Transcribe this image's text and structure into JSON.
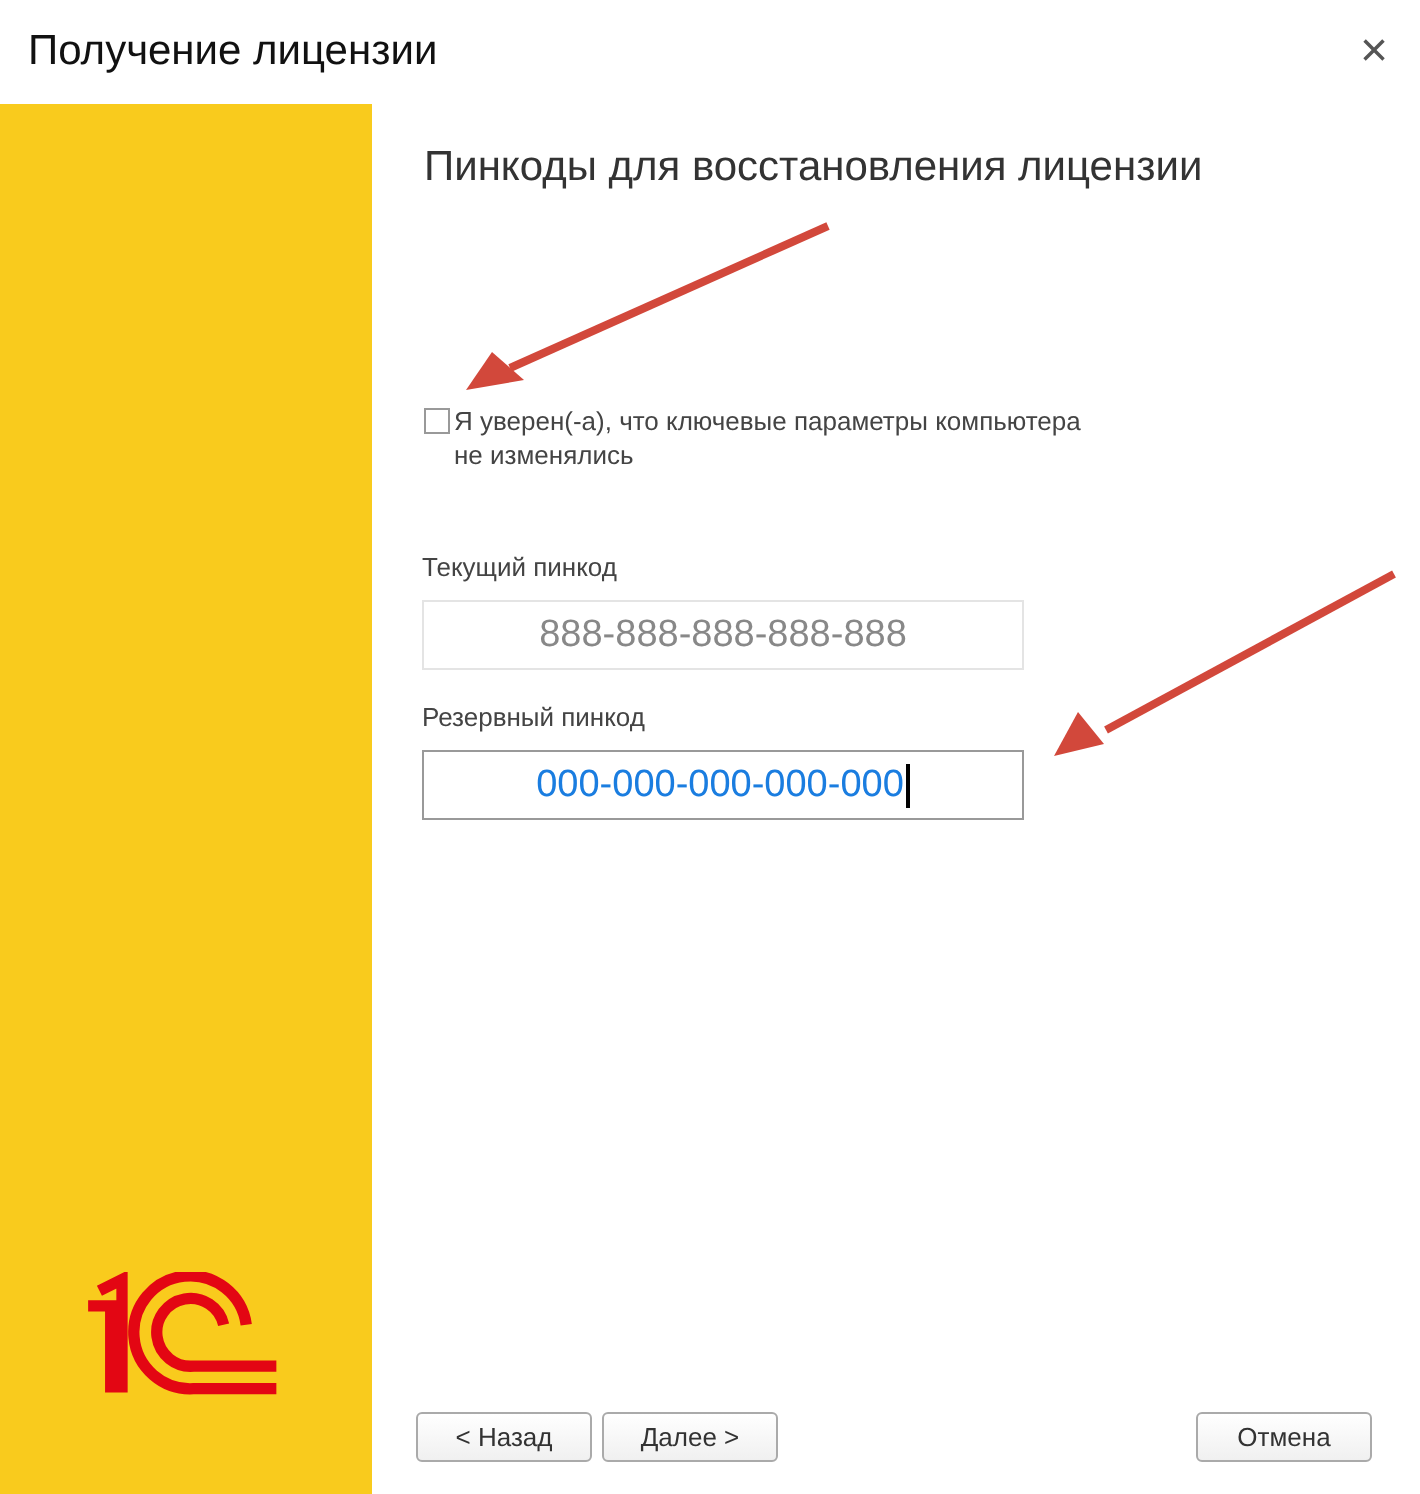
{
  "window": {
    "title": "Получение лицензии",
    "close": "×"
  },
  "heading": "Пинкоды для восстановления лицензии",
  "confirm": {
    "label": "Я уверен(-а), что ключевые параметры компьютера не изменялись",
    "checked": false
  },
  "fields": [
    {
      "label": "Текущий пинкод",
      "value": "888-888-888-888-888",
      "disabled": true,
      "focused": false
    },
    {
      "label": "Резервный пинкод",
      "value": "000-000-000-000-000",
      "disabled": false,
      "focused": true
    }
  ],
  "buttons": [
    {
      "label": "< Назад",
      "kind": "nav"
    },
    {
      "label": "Далее >",
      "kind": "nav"
    },
    {
      "label": "Отмена",
      "kind": "cancel"
    }
  ]
}
